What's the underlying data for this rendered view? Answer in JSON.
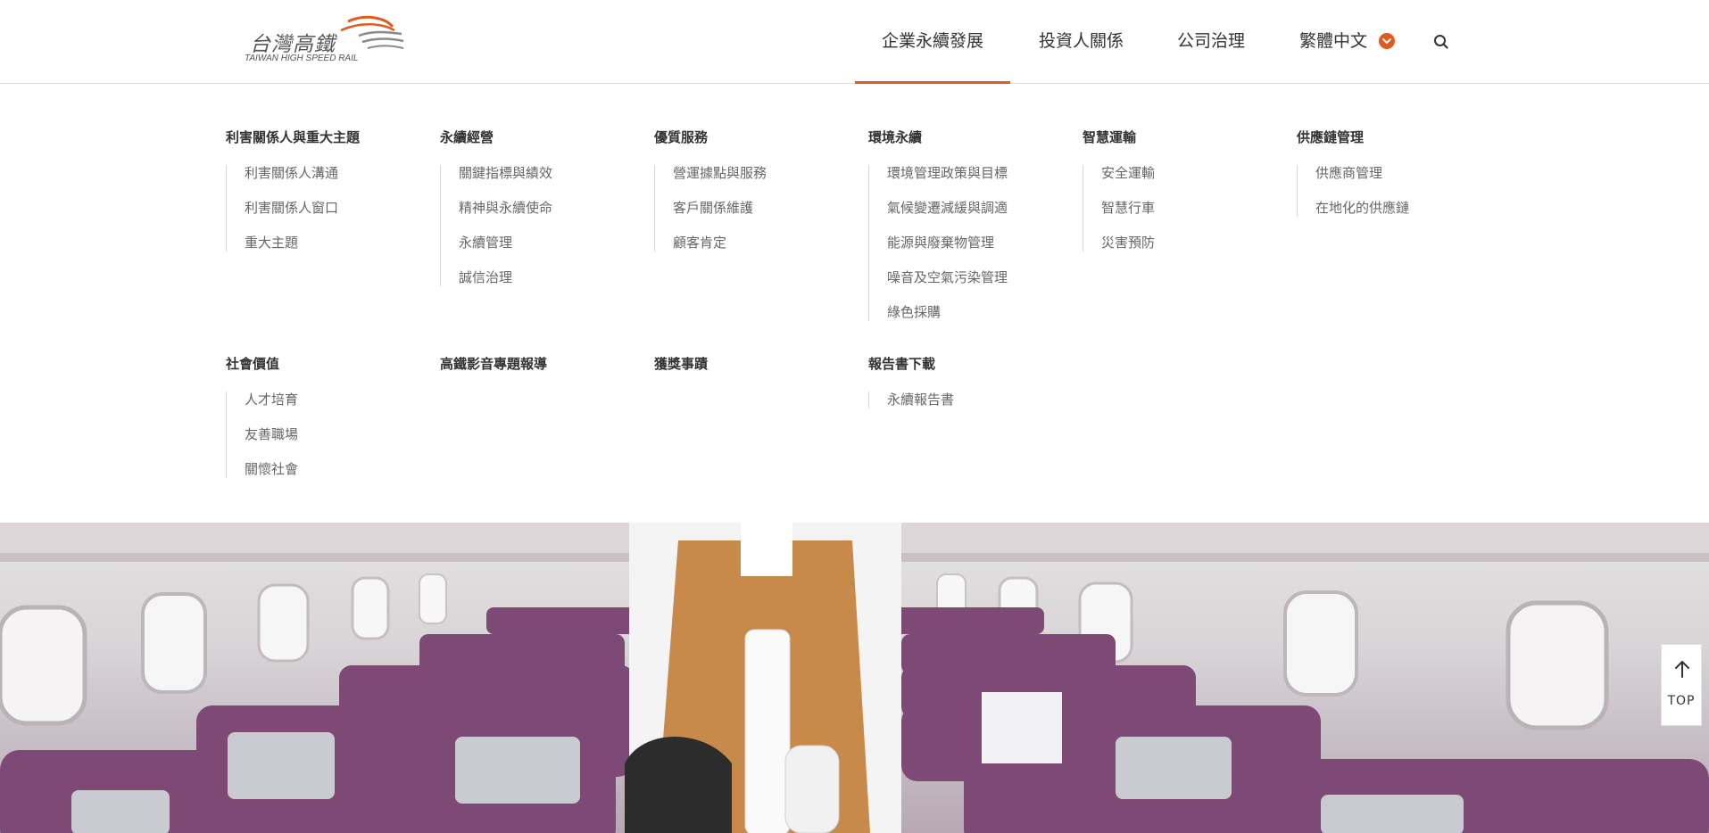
{
  "brand": {
    "name_zh": "台灣高鐵",
    "name_en": "TAIWAN HIGH SPEED RAIL",
    "accent_color": "#e15a1e"
  },
  "nav": {
    "items": [
      {
        "label": "企業永續發展",
        "active": true
      },
      {
        "label": "投資人關係",
        "active": false
      },
      {
        "label": "公司治理",
        "active": false
      },
      {
        "label": "繁體中文",
        "active": false
      }
    ],
    "lang_icon": "chevron-down-circle-icon",
    "search_icon": "search-icon"
  },
  "menu": {
    "columns": [
      {
        "title": "利害關係人與重大主題",
        "items": [
          "利害關係人溝通",
          "利害關係人窗口",
          "重大主題"
        ]
      },
      {
        "title": "永續經營",
        "items": [
          "關鍵指標與績效",
          "精神與永續使命",
          "永續管理",
          "誠信治理"
        ]
      },
      {
        "title": "優質服務",
        "items": [
          "營運據點與服務",
          "客戶關係維護",
          "顧客肯定"
        ]
      },
      {
        "title": "環境永續",
        "items": [
          "環境管理政策與目標",
          "氣候變遷減緩與調適",
          "能源與廢棄物管理",
          "噪音及空氣污染管理",
          "綠色採購"
        ]
      },
      {
        "title": "智慧運輸",
        "items": [
          "安全運輸",
          "智慧行車",
          "災害預防"
        ]
      },
      {
        "title": "供應鏈管理",
        "items": [
          "供應商管理",
          "在地化的供應鏈"
        ]
      },
      {
        "title": "社會價值",
        "items": [
          "人才培育",
          "友善職場",
          "關懷社會"
        ]
      },
      {
        "title": "高鐵影音專題報導",
        "items": []
      },
      {
        "title": "獲獎事蹟",
        "items": []
      },
      {
        "title": "報告書下載",
        "items": [
          "永續報告書"
        ]
      }
    ]
  },
  "back_to_top": {
    "label": "TOP",
    "icon": "arrow-up-icon"
  },
  "hero": {
    "image": "train-cabin-attendant-photo"
  }
}
